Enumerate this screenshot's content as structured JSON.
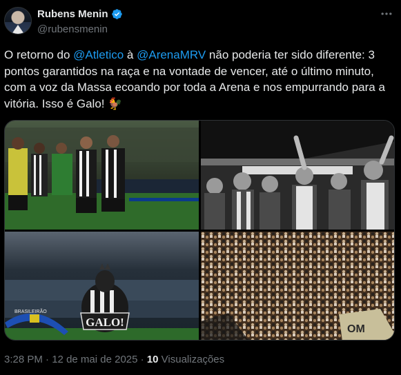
{
  "author": {
    "name": "Rubens Menin",
    "handle": "@rubensmenin",
    "verified_color": "#1d9bf0",
    "avatar_icon": "avatar-photo"
  },
  "tweet": {
    "seg1": "O retorno do ",
    "mention1": "@Atletico",
    "seg2": " à ",
    "mention2": "@ArenaMRV",
    "seg3": " não poderia ter sido diferente: 3 pontos garantidos na raça e na vontade de vencer, até o último minuto, com a voz da Massa ecoando por toda a Arena e nos empurrando para a vitória. Isso é Galo! ",
    "emoji": "🐓"
  },
  "media": {
    "photos": [
      {
        "name": "players-celebrating-photo"
      },
      {
        "name": "fans-celebrating-bw-photo"
      },
      {
        "name": "stadium-rooster-mascot-photo",
        "banner_text": "GALO!",
        "sign_text": "BRASILEIRÃO"
      },
      {
        "name": "crowd-stands-photo",
        "flag_text": "OM"
      }
    ]
  },
  "footer": {
    "time": "3:28 PM",
    "sep1": " · ",
    "date": "12 de mai de 2025",
    "sep2": " · ",
    "views_count": "10",
    "views_label": " Visualizações"
  },
  "colors": {
    "background": "#000000",
    "text": "#e7e9ea",
    "muted": "#71767b",
    "link": "#1d9bf0",
    "border": "#2f3336"
  }
}
